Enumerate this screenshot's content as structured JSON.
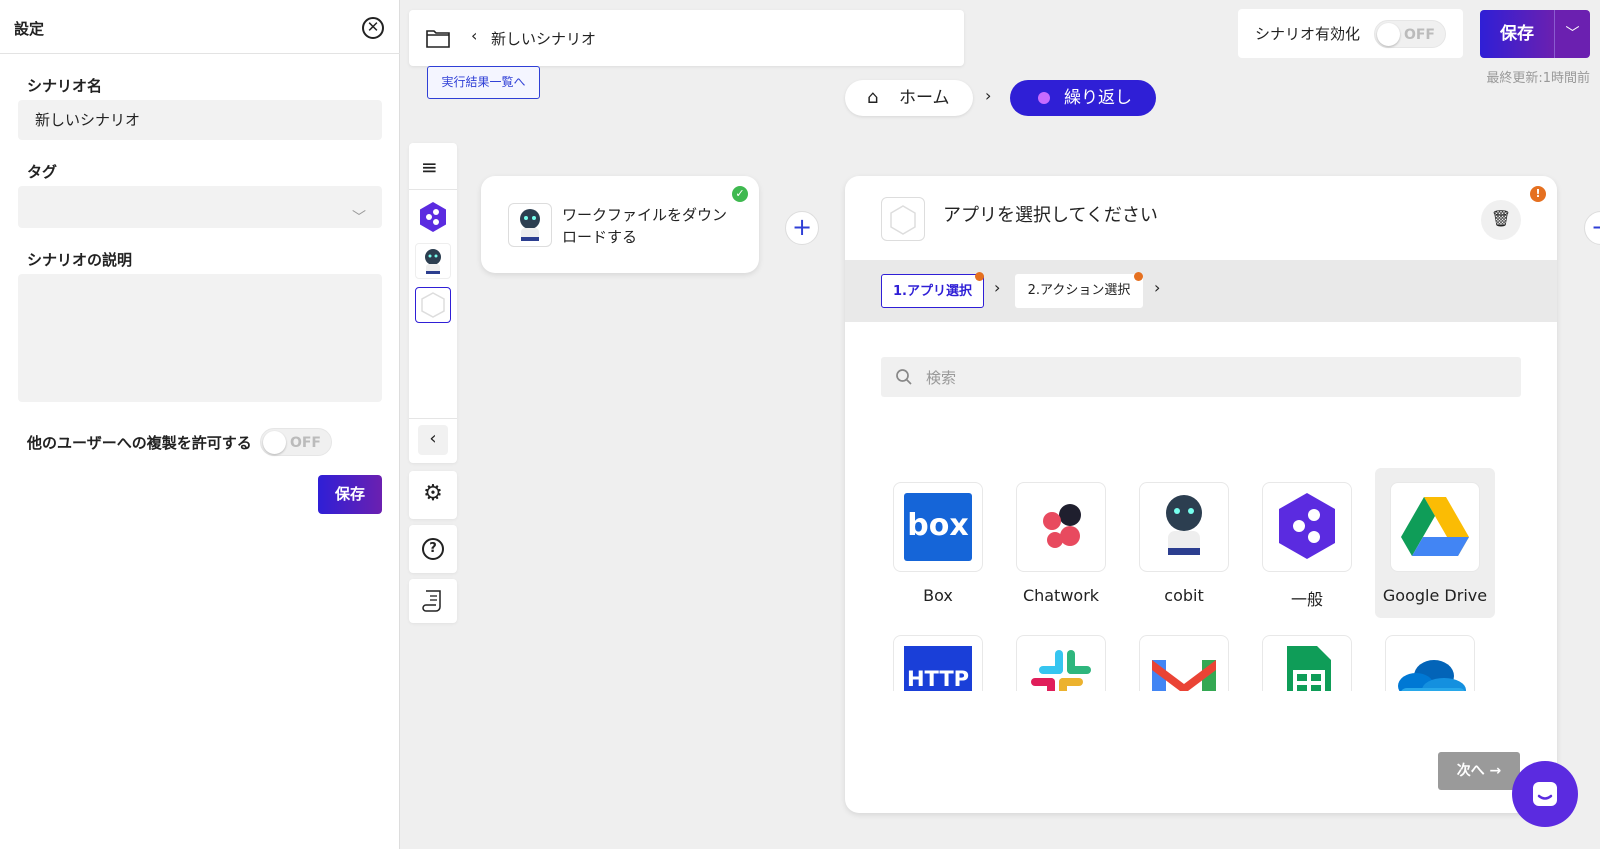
{
  "settings": {
    "title": "設定",
    "scenario_name_label": "シナリオ名",
    "scenario_name_value": "新しいシナリオ",
    "tag_label": "タグ",
    "tag_value": "",
    "description_label": "シナリオの説明",
    "description_value": "",
    "allow_copy_label": "他のユーザーへの複製を許可する",
    "allow_copy_toggle": "OFF",
    "save_label": "保存"
  },
  "topbar": {
    "scenario_title": "新しいシナリオ",
    "results_link": "実行結果一覧へ",
    "enable_label": "シナリオ有効化",
    "enable_toggle": "OFF",
    "save_label": "保存",
    "last_updated": "最終更新:1時間前"
  },
  "breadcrumb": {
    "home": "ホーム",
    "current": "繰り返し"
  },
  "step1": {
    "label": "ワークファイルをダウンロードする"
  },
  "step_panel": {
    "title": "アプリを選択してください",
    "tab1": "1.アプリ選択",
    "tab2": "2.アクション選択",
    "search_placeholder": "検索",
    "next_label": "次へ →"
  },
  "apps": [
    {
      "name": "Box"
    },
    {
      "name": "Chatwork"
    },
    {
      "name": "cobit"
    },
    {
      "name": "一般"
    },
    {
      "name": "Google Drive"
    }
  ],
  "colors": {
    "accent": "#2f1fd6",
    "accent2": "#6b20b0",
    "warn": "#e57020",
    "ok": "#3fb950"
  }
}
